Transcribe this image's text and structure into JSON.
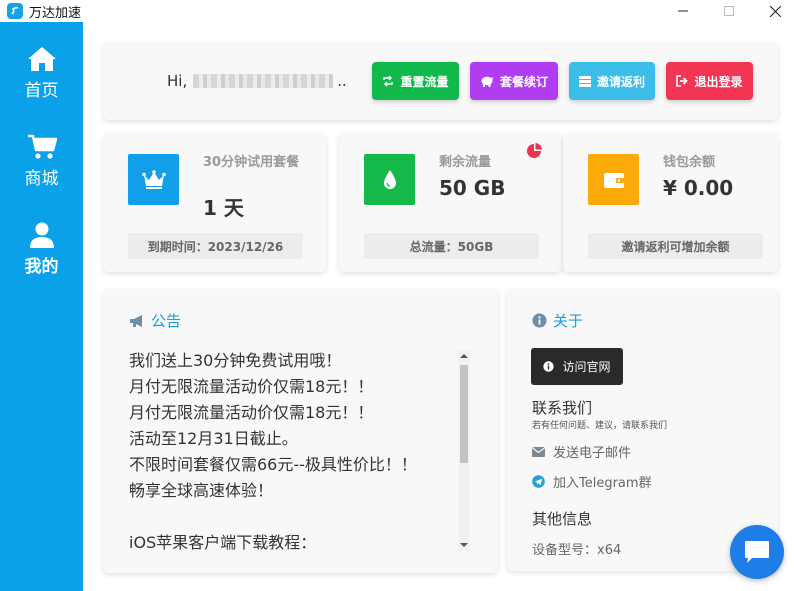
{
  "window": {
    "title": "万达加速",
    "icons": [
      "app-logo-icon",
      "minimize-icon",
      "maximize-icon",
      "close-icon"
    ]
  },
  "sidebar": {
    "items": [
      {
        "label": "首页",
        "icon": "home-icon"
      },
      {
        "label": "商城",
        "icon": "cart-icon"
      },
      {
        "label": "我的",
        "icon": "user-icon",
        "active": true
      }
    ],
    "color": "#0aa1e8"
  },
  "greeting": {
    "prefix": "Hi,",
    "suffix": ".."
  },
  "actions": [
    {
      "label": "重置流量",
      "icon": "reset-icon",
      "color": "#11b84b"
    },
    {
      "label": "套餐续订",
      "icon": "piggy-bank-icon",
      "color": "#b13df0"
    },
    {
      "label": "邀请返利",
      "icon": "invite-icon",
      "color": "#3bbce9"
    },
    {
      "label": "退出登录",
      "icon": "logout-icon",
      "color": "#f23553"
    }
  ],
  "stats": [
    {
      "label": "30分钟试用套餐",
      "value": "1 天",
      "footer": "到期时间：2023/12/26",
      "icon": "crown-icon",
      "color": "#109fe8"
    },
    {
      "label": "剩余流量",
      "value": "50 GB",
      "footer": "总流量：50GB",
      "icon": "drop-icon",
      "color": "#14b94a"
    },
    {
      "label": "钱包余额",
      "value": "¥ 0.00",
      "footer": "邀请返利可增加余额",
      "icon": "wallet-icon",
      "color": "#fbaa0a"
    }
  ],
  "notice": {
    "title": "公告",
    "lines": [
      "我们送上30分钟免费试用哦！",
      "月付无限流量活动价仅需18元！！",
      "月付无限流量活动价仅需18元！！",
      "活动至12月31日截止。",
      "不限时间套餐仅需66元--极具性价比！！",
      "畅享全球高速体验！",
      "",
      "iOS苹果客户端下载教程："
    ]
  },
  "about": {
    "title": "关于",
    "visit_label": "访问官网",
    "contact_title": "联系我们",
    "contact_sub": "若有任何问题、建议，请联系我们",
    "email_label": "发送电子邮件",
    "telegram_label": "加入Telegram群",
    "other_title": "其他信息",
    "device": "设备型号：x64"
  },
  "colors": {
    "accent": "#1a9edb",
    "chat_fab": "#1f7de8"
  }
}
